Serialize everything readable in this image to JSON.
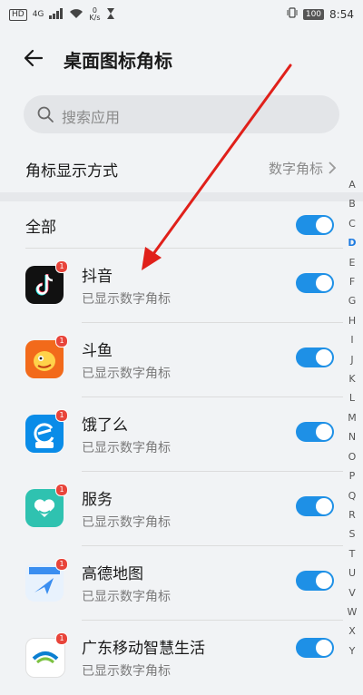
{
  "status_bar": {
    "left_badge": "HD",
    "network": "4G",
    "speed_value": "0",
    "speed_unit": "K/s",
    "battery": "100",
    "time": "8:54"
  },
  "header": {
    "title": "桌面图标角标",
    "back_icon": "arrow-left-icon"
  },
  "search": {
    "placeholder": "搜索应用"
  },
  "badge_mode": {
    "label": "角标显示方式",
    "value": "数字角标"
  },
  "all": {
    "label": "全部",
    "enabled": true
  },
  "apps": [
    {
      "name": "抖音",
      "status": "已显示数字角标",
      "badge": "1",
      "enabled": true,
      "icon": "douyin-icon",
      "color": "#1a1a1a"
    },
    {
      "name": "斗鱼",
      "status": "已显示数字角标",
      "badge": "1",
      "enabled": true,
      "icon": "douyu-icon",
      "color": "#f26a1b"
    },
    {
      "name": "饿了么",
      "status": "已显示数字角标",
      "badge": "1",
      "enabled": true,
      "icon": "eleme-icon",
      "color": "#0a8ce8"
    },
    {
      "name": "服务",
      "status": "已显示数字角标",
      "badge": "1",
      "enabled": true,
      "icon": "service-heart-icon",
      "color": "#2fc2b0"
    },
    {
      "name": "高德地图",
      "status": "已显示数字角标",
      "badge": "1",
      "enabled": true,
      "icon": "amap-icon",
      "color": "#3a8ef0"
    },
    {
      "name": "广东移动智慧生活",
      "status": "已显示数字角标",
      "badge": "1",
      "enabled": true,
      "icon": "china-mobile-icon",
      "color": "#0b7fd1"
    }
  ],
  "index_letters": [
    "A",
    "B",
    "C",
    "D",
    "E",
    "F",
    "G",
    "H",
    "I",
    "J",
    "K",
    "L",
    "M",
    "N",
    "O",
    "P",
    "Q",
    "R",
    "S",
    "T",
    "U",
    "V",
    "W",
    "X",
    "Y"
  ],
  "index_active": "D",
  "colors": {
    "accent": "#1e90e6",
    "badge_red": "#e8443a",
    "annotation_arrow": "#e0201a"
  }
}
